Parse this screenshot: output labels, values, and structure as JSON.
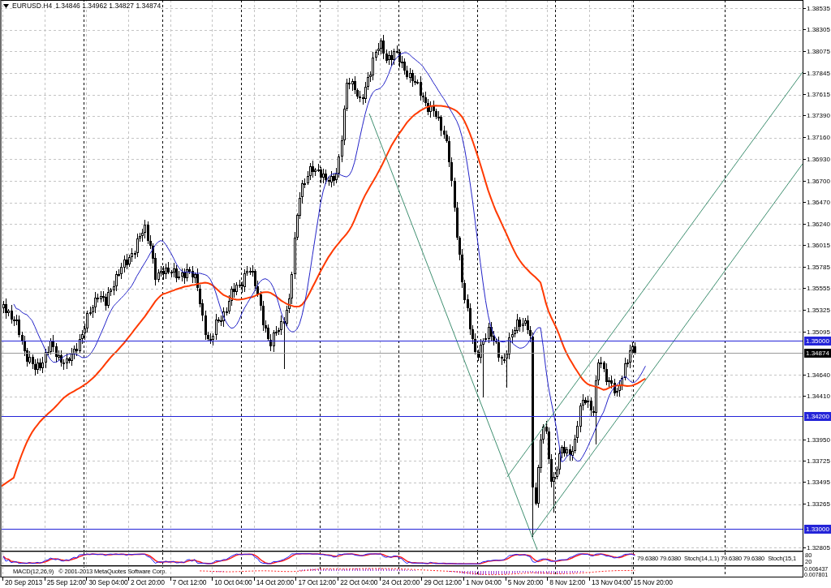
{
  "chart": {
    "symbol": "EURUSD.H4",
    "quote": "1.34846 1.34962 1.34827 1.34874",
    "price_axis": [
      "1.38535",
      "1.38305",
      "1.38075",
      "1.37845",
      "1.37615",
      "1.37390",
      "1.37160",
      "1.36930",
      "1.36700",
      "1.36470",
      "1.36240",
      "1.36015",
      "1.35785",
      "1.35555",
      "1.35325",
      "1.35095",
      "1.34640",
      "1.34410",
      "1.33950",
      "1.33725",
      "1.33495",
      "1.33265",
      "1.32805"
    ],
    "price_labels": [
      {
        "kind": "level",
        "text": "1.35000"
      },
      {
        "kind": "bid",
        "text": "1.34874"
      },
      {
        "kind": "level",
        "text": "1.34200"
      },
      {
        "kind": "level",
        "text": "1.33000"
      }
    ]
  },
  "stochastic": {
    "legend": [
      "79.6380 79.6380",
      "Stoch(14,1,1) 79.6380 79.6380",
      "Stoch(15,1"
    ],
    "axis": [
      "80",
      "20"
    ]
  },
  "macd": {
    "legend": "MACD(12,26,9)",
    "copyright": "© 2001-2013 MetaQuotes Software Corp.",
    "axis": [
      "0.006437",
      "0.007801"
    ]
  },
  "time_axis": [
    "20 Sep 2013",
    "25 Sep 12:00",
    "30 Sep 04:00",
    "2 Oct 20:00",
    "7 Oct 12:00",
    "10 Oct 04:00",
    "14 Oct 20:00",
    "17 Oct 12:00",
    "22 Oct 04:00",
    "24 Oct 20:00",
    "29 Oct 12:00",
    "1 Nov 04:00",
    "5 Nov 20:00",
    "8 Nov 12:00",
    "13 Nov 04:00",
    "15 Nov 20:00"
  ]
}
